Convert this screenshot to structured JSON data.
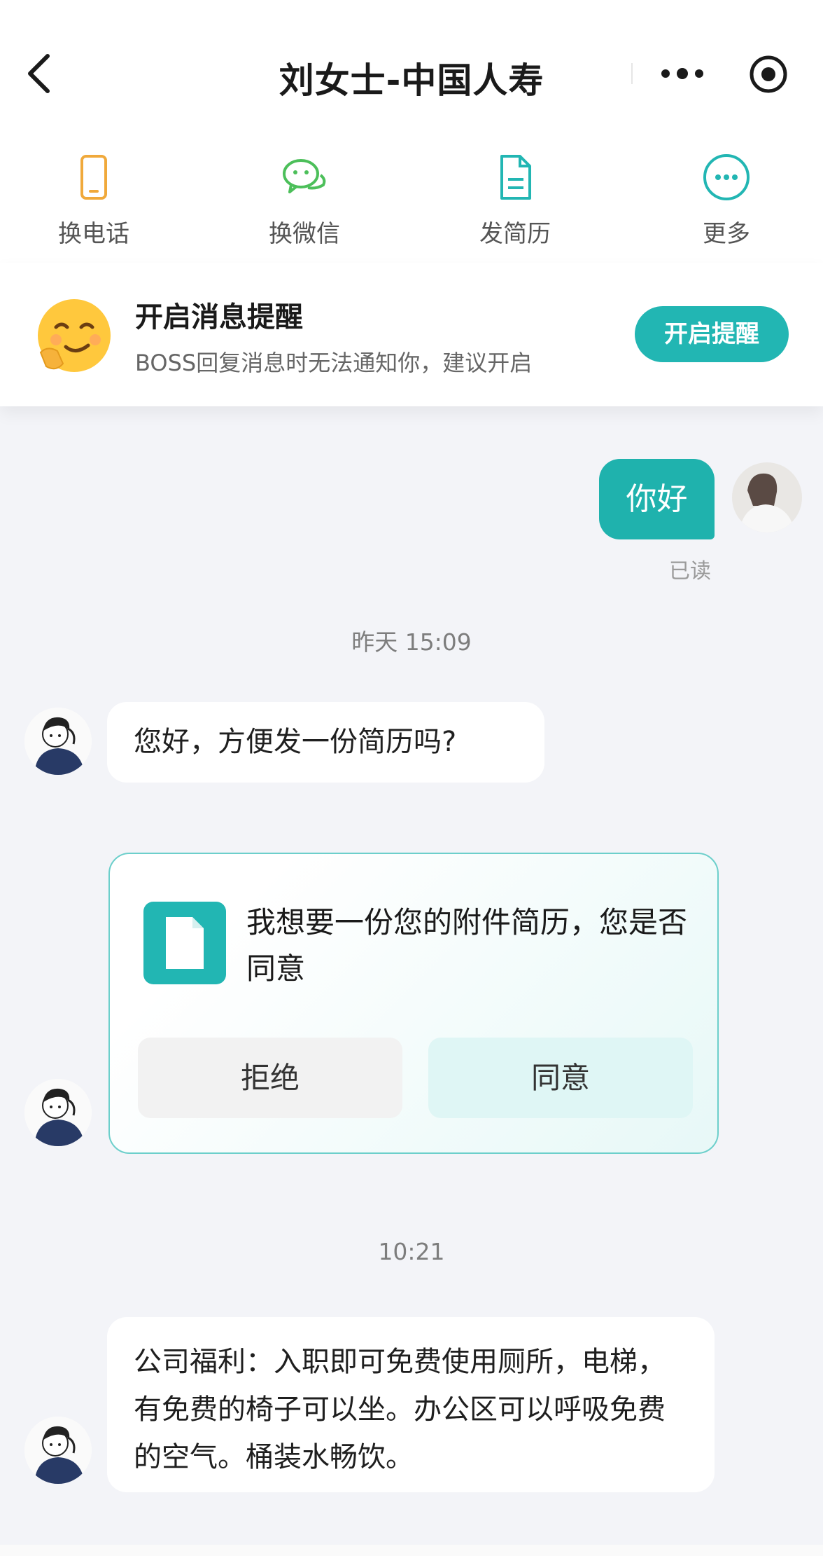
{
  "header": {
    "title": "刘女士-中国人寿"
  },
  "actions": [
    {
      "label": "换电话",
      "icon": "phone-icon",
      "color": "#f0a93b"
    },
    {
      "label": "换微信",
      "icon": "wechat-icon",
      "color": "#4cbf5a"
    },
    {
      "label": "发简历",
      "icon": "document-icon",
      "color": "#22b6b3"
    },
    {
      "label": "更多",
      "icon": "more-circle-icon",
      "color": "#22b6b3"
    }
  ],
  "notify": {
    "title": "开启消息提醒",
    "text": "BOSS回复消息时无法通知你，建议开启",
    "button": "开启提醒"
  },
  "messages": {
    "me_text": "你好",
    "me_status": "已读",
    "time1": "昨天 15:09",
    "hr_msg1": "您好，方便发一份简历吗?",
    "card_text": "我想要一份您的附件简历，您是否同意",
    "card_reject": "拒绝",
    "card_agree": "同意",
    "time2": "10:21",
    "hr_msg2": "公司福利：入职即可免费使用厕所，电梯，有免费的椅子可以坐。办公区可以呼吸免费的空气。桶装水畅饮。"
  },
  "colors": {
    "accent": "#22b6b3",
    "background": "#f3f4f8"
  }
}
